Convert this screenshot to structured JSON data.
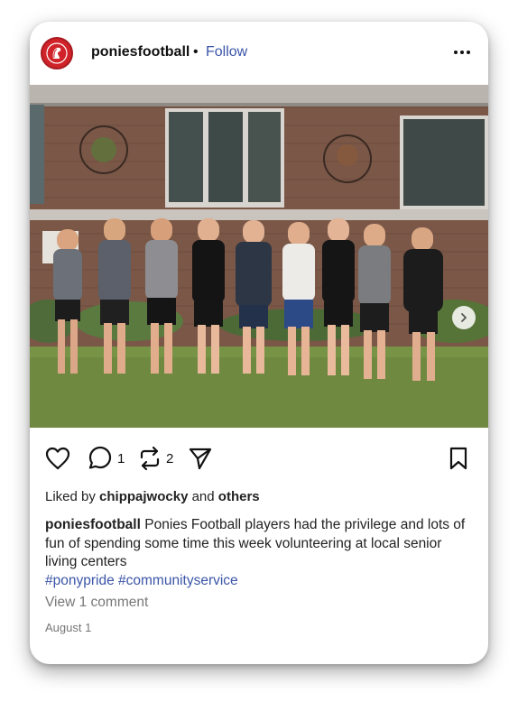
{
  "post": {
    "username": "poniesfootball",
    "separator": "•",
    "follow_label": "Follow",
    "more_icon": "more-horizontal-icon",
    "photo_alt": "Photo",
    "carousel": {
      "count": 10,
      "active_index": 0
    },
    "actions": {
      "like_icon": "heart-icon",
      "comment_icon": "comment-icon",
      "comment_count": "1",
      "repost_icon": "repost-icon",
      "repost_count": "2",
      "share_icon": "send-icon",
      "save_icon": "bookmark-icon"
    },
    "liked_by": {
      "prefix": "Liked by",
      "user": "chippajwocky",
      "conjunction": "and",
      "others": "others"
    },
    "caption": {
      "user": "poniesfootball",
      "text": "Ponies Football players had the privilege and lots of fun of spending some time this week volunteering at local senior living centers",
      "hashtags": [
        "#ponypride",
        "#communityservice"
      ]
    },
    "view_comments": "View 1 comment",
    "date": "August 1"
  },
  "colors": {
    "link": "#3b55a8",
    "avatar_red": "#d0232a",
    "muted": "#777777"
  }
}
